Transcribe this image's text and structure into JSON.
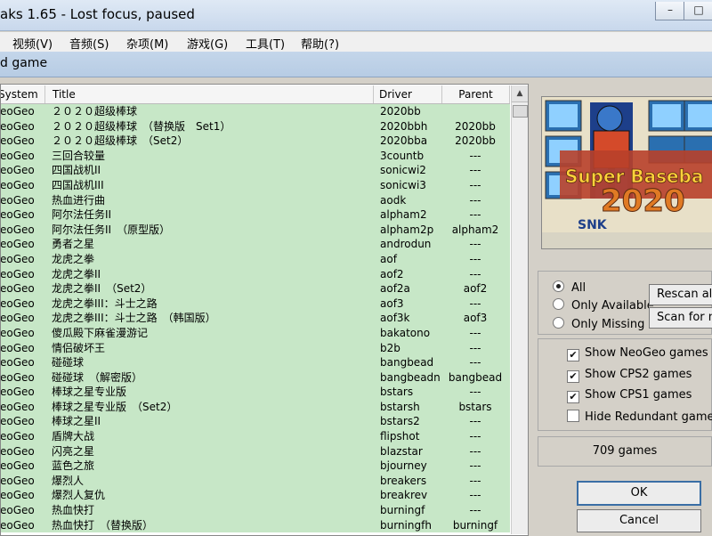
{
  "window": {
    "title": "aks 1.65 - Lost focus, paused",
    "minimize_glyph": "–",
    "maximize_glyph": "□"
  },
  "menu": [
    "视频(V)",
    "音频(S)",
    "杂项(M)",
    "游戏(G)",
    "工具(T)",
    "帮助(?)"
  ],
  "dialog": {
    "title": "d game"
  },
  "list": {
    "columns": {
      "system": "System",
      "title": "Title",
      "driver": "Driver",
      "parent": "Parent"
    },
    "rows": [
      {
        "system": "NeoGeo",
        "title": "２０２０超级棒球",
        "driver": "2020bb",
        "parent": ""
      },
      {
        "system": "NeoGeo",
        "title": "２０２０超级棒球　（替换版　Set1）",
        "driver": "2020bbh",
        "parent": "2020bb"
      },
      {
        "system": "NeoGeo",
        "title": "２０２０超级棒球　（Set2）",
        "driver": "2020bba",
        "parent": "2020bb"
      },
      {
        "system": "NeoGeo",
        "title": "三回合较量",
        "driver": "3countb",
        "parent": "---"
      },
      {
        "system": "NeoGeo",
        "title": "四国战机II",
        "driver": "sonicwi2",
        "parent": "---"
      },
      {
        "system": "NeoGeo",
        "title": "四国战机III",
        "driver": "sonicwi3",
        "parent": "---"
      },
      {
        "system": "NeoGeo",
        "title": "热血进行曲",
        "driver": "aodk",
        "parent": "---"
      },
      {
        "system": "NeoGeo",
        "title": "阿尔法任务II",
        "driver": "alpham2",
        "parent": "---"
      },
      {
        "system": "NeoGeo",
        "title": "阿尔法任务II　（原型版）",
        "driver": "alpham2p",
        "parent": "alpham2"
      },
      {
        "system": "NeoGeo",
        "title": "勇者之星",
        "driver": "androdun",
        "parent": "---"
      },
      {
        "system": "NeoGeo",
        "title": "龙虎之拳",
        "driver": "aof",
        "parent": "---"
      },
      {
        "system": "NeoGeo",
        "title": "龙虎之拳II",
        "driver": "aof2",
        "parent": "---"
      },
      {
        "system": "NeoGeo",
        "title": "龙虎之拳II　（Set2）",
        "driver": "aof2a",
        "parent": "aof2"
      },
      {
        "system": "NeoGeo",
        "title": "龙虎之拳III：斗士之路",
        "driver": "aof3",
        "parent": "---"
      },
      {
        "system": "NeoGeo",
        "title": "龙虎之拳III：斗士之路　（韩国版）",
        "driver": "aof3k",
        "parent": "aof3"
      },
      {
        "system": "NeoGeo",
        "title": "傻瓜殿下麻雀漫游记",
        "driver": "bakatono",
        "parent": "---"
      },
      {
        "system": "NeoGeo",
        "title": "情侣破坏王",
        "driver": "b2b",
        "parent": "---"
      },
      {
        "system": "NeoGeo",
        "title": "碰碰球",
        "driver": "bangbead",
        "parent": "---"
      },
      {
        "system": "NeoGeo",
        "title": "碰碰球　（解密版）",
        "driver": "bangbeadn",
        "parent": "bangbead"
      },
      {
        "system": "NeoGeo",
        "title": "棒球之星专业版",
        "driver": "bstars",
        "parent": "---"
      },
      {
        "system": "NeoGeo",
        "title": "棒球之星专业版　（Set2）",
        "driver": "bstarsh",
        "parent": "bstars"
      },
      {
        "system": "NeoGeo",
        "title": "棒球之星II",
        "driver": "bstars2",
        "parent": "---"
      },
      {
        "system": "NeoGeo",
        "title": "盾牌大战",
        "driver": "flipshot",
        "parent": "---"
      },
      {
        "system": "NeoGeo",
        "title": "闪亮之星",
        "driver": "blazstar",
        "parent": "---"
      },
      {
        "system": "NeoGeo",
        "title": "蓝色之旅",
        "driver": "bjourney",
        "parent": "---"
      },
      {
        "system": "NeoGeo",
        "title": "爆烈人",
        "driver": "breakers",
        "parent": "---"
      },
      {
        "system": "NeoGeo",
        "title": "爆烈人复仇",
        "driver": "breakrev",
        "parent": "---"
      },
      {
        "system": "NeoGeo",
        "title": "热血快打",
        "driver": "burningf",
        "parent": "---"
      },
      {
        "system": "NeoGeo",
        "title": "热血快打　（替换版）",
        "driver": "burningfh",
        "parent": "burningf"
      }
    ]
  },
  "preview": {
    "logo_text": "Super Baseba",
    "year_text": "2020",
    "brand_text": "SNK"
  },
  "filter_group": {
    "options": [
      {
        "label": "All",
        "selected": true
      },
      {
        "label": "Only Available",
        "selected": false
      },
      {
        "label": "Only Missing",
        "selected": false
      }
    ],
    "rescan_button": "Rescan al",
    "scan_button": "Scan for ne"
  },
  "checks_group": {
    "items": [
      {
        "label": "Show NeoGeo games",
        "checked": true
      },
      {
        "label": "Show CPS2 games",
        "checked": true
      },
      {
        "label": "Show CPS1 games",
        "checked": true
      },
      {
        "label": "Hide Redundant games",
        "checked": false
      }
    ]
  },
  "count_label": "709 games",
  "ok_button": "OK",
  "cancel_button": "Cancel",
  "colors": {
    "row_bg": "#c7e7c7",
    "title_bar": "#c8d8ec",
    "dialog_header": "#b7cce4"
  }
}
